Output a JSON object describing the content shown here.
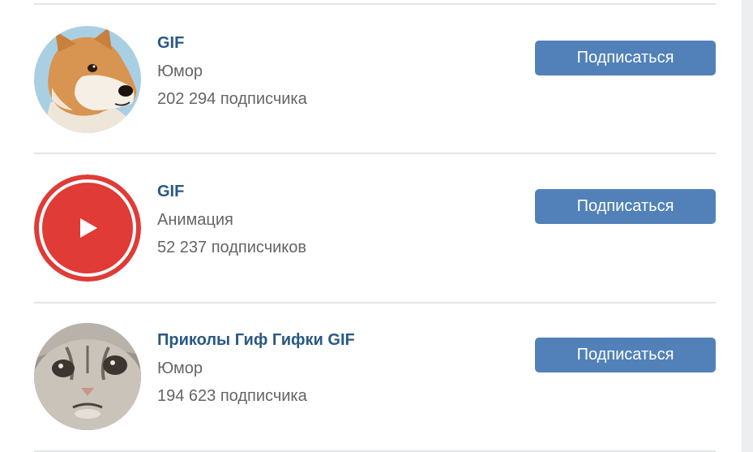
{
  "subscribe_label": "Подписаться",
  "communities": [
    {
      "name": "GIF",
      "category": "Юмор",
      "subscribers": "202 294 подписчика",
      "avatar_icon": "shiba-dog-avatar"
    },
    {
      "name": "GIF",
      "category": "Анимация",
      "subscribers": "52 237 подписчиков",
      "avatar_icon": "red-play-avatar"
    },
    {
      "name": "Приколы Гиф Гифки GIF",
      "category": "Юмор",
      "subscribers": "194 623 подписчика",
      "avatar_icon": "grumpy-cat-avatar"
    }
  ],
  "colors": {
    "link": "#2a5885",
    "button": "#5181b8",
    "secondary_text": "#656565",
    "play_red": "#e03b36"
  }
}
